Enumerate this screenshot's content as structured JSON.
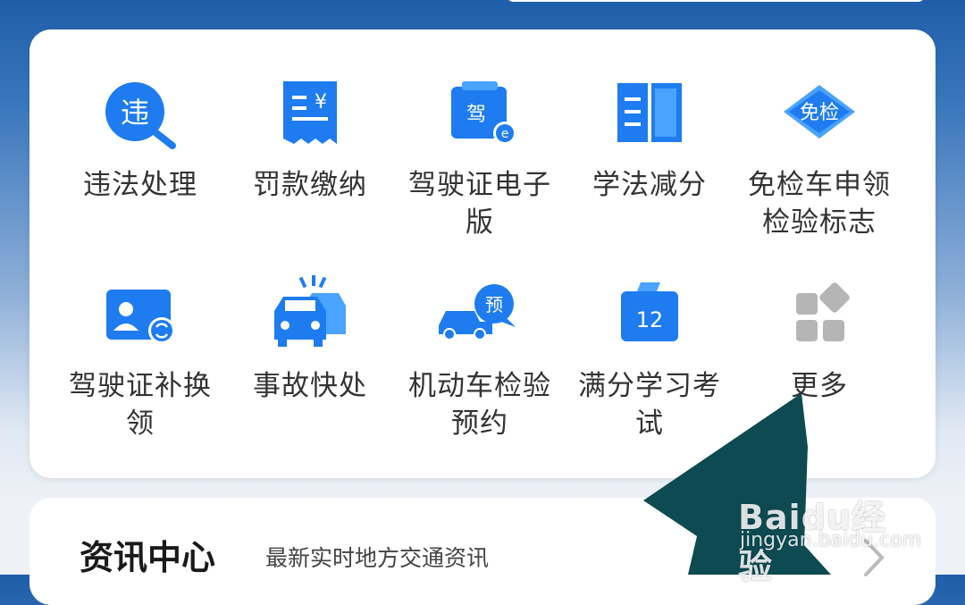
{
  "services": [
    {
      "label": "违法处理",
      "icon": "violation-search-icon",
      "glyph": "违"
    },
    {
      "label": "罚款缴纳",
      "icon": "receipt-icon",
      "glyph": "¥"
    },
    {
      "label": "驾驶证电子版",
      "icon": "e-license-icon",
      "glyph": "驾"
    },
    {
      "label": "学法减分",
      "icon": "open-book-icon"
    },
    {
      "label": "免检车申领检验标志",
      "icon": "exempt-badge-icon",
      "glyph": "免检"
    },
    {
      "label": "驾驶证补换领",
      "icon": "license-renew-icon"
    },
    {
      "label": "事故快处",
      "icon": "car-accident-icon"
    },
    {
      "label": "机动车检验预约",
      "icon": "inspection-booking-icon",
      "glyph": "预"
    },
    {
      "label": "满分学习考试",
      "icon": "calendar-12-icon",
      "glyph": "12"
    },
    {
      "label": "更多",
      "icon": "more-grid-icon"
    }
  ],
  "news": {
    "title": "资讯中心",
    "subtitle": "最新实时地方交通资讯"
  },
  "watermark": {
    "logo": "Baidu经验",
    "url": "jingyan.baidu.com"
  },
  "colors": {
    "accent": "#1e7cf0",
    "accent_light": "#4aa3ff",
    "more_gray": "#b5b5b5",
    "arrow": "#0d4a52"
  }
}
